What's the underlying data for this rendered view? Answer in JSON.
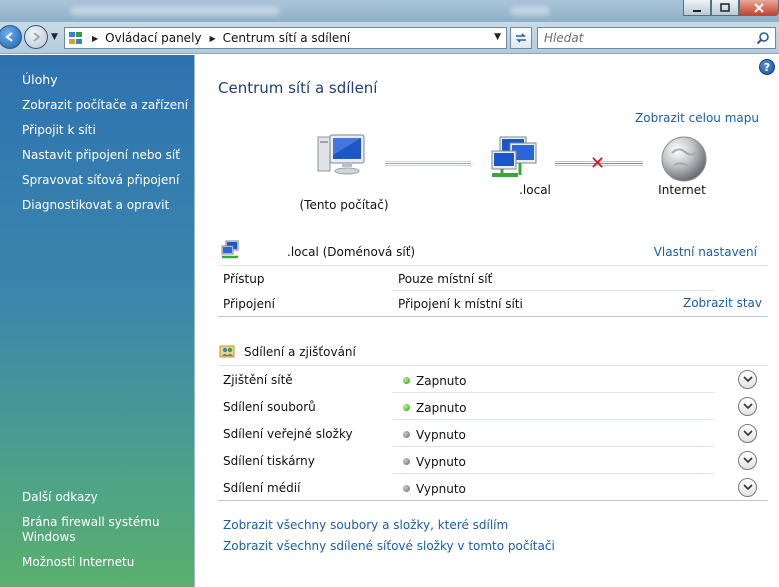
{
  "window": {
    "minimize_icon": "minimize-icon",
    "maximize_icon": "maximize-icon",
    "close_icon": "close-icon"
  },
  "address_bar": {
    "breadcrumbs": [
      "Ovládací panely",
      "Centrum sítí a sdílení"
    ]
  },
  "search": {
    "placeholder": "Hledat"
  },
  "sidebar": {
    "tasks_title": "Úlohy",
    "tasks": [
      "Zobrazit počítače a zařízení",
      "Připojit k síti",
      "Nastavit připojení nebo síť",
      "Spravovat síťová připojení",
      "Diagnostikovat a opravit"
    ],
    "see_also_title": "Další odkazy",
    "see_also": [
      "Brána firewall systému Windows",
      "Možnosti Internetu"
    ]
  },
  "main": {
    "title": "Centrum sítí a sdílení",
    "full_map_link": "Zobrazit celou mapu",
    "map": {
      "this_computer": "(Tento počítač)",
      "network": ".local",
      "internet": "Internet"
    },
    "network": {
      "name": ".local (Doménová síť)",
      "customize_link": "Vlastní nastavení",
      "rows": [
        {
          "label": "Přístup",
          "value": "Pouze místní síť",
          "link": ""
        },
        {
          "label": "Připojení",
          "value": "Připojení k místní síti",
          "link": "Zobrazit stav"
        }
      ]
    },
    "sharing": {
      "title": "Sdílení a zjišťování",
      "rows": [
        {
          "label": "Zjištění sítě",
          "state": "Zapnuto",
          "on": true
        },
        {
          "label": "Sdílení souborů",
          "state": "Zapnuto",
          "on": true
        },
        {
          "label": "Sdílení veřejné složky",
          "state": "Vypnuto",
          "on": false
        },
        {
          "label": "Sdílení tiskárny",
          "state": "Vypnuto",
          "on": false
        },
        {
          "label": "Sdílení médií",
          "state": "Vypnuto",
          "on": false
        }
      ]
    },
    "bottom_links": [
      "Zobrazit všechny soubory a složky, které sdílím",
      "Zobrazit všechny sdílené síťové složky v tomto počítači"
    ]
  },
  "colors": {
    "link": "#1a5ea8",
    "title": "#1e3f7a",
    "status_on": "#2c9a13",
    "status_off": "#6b6b6b"
  }
}
